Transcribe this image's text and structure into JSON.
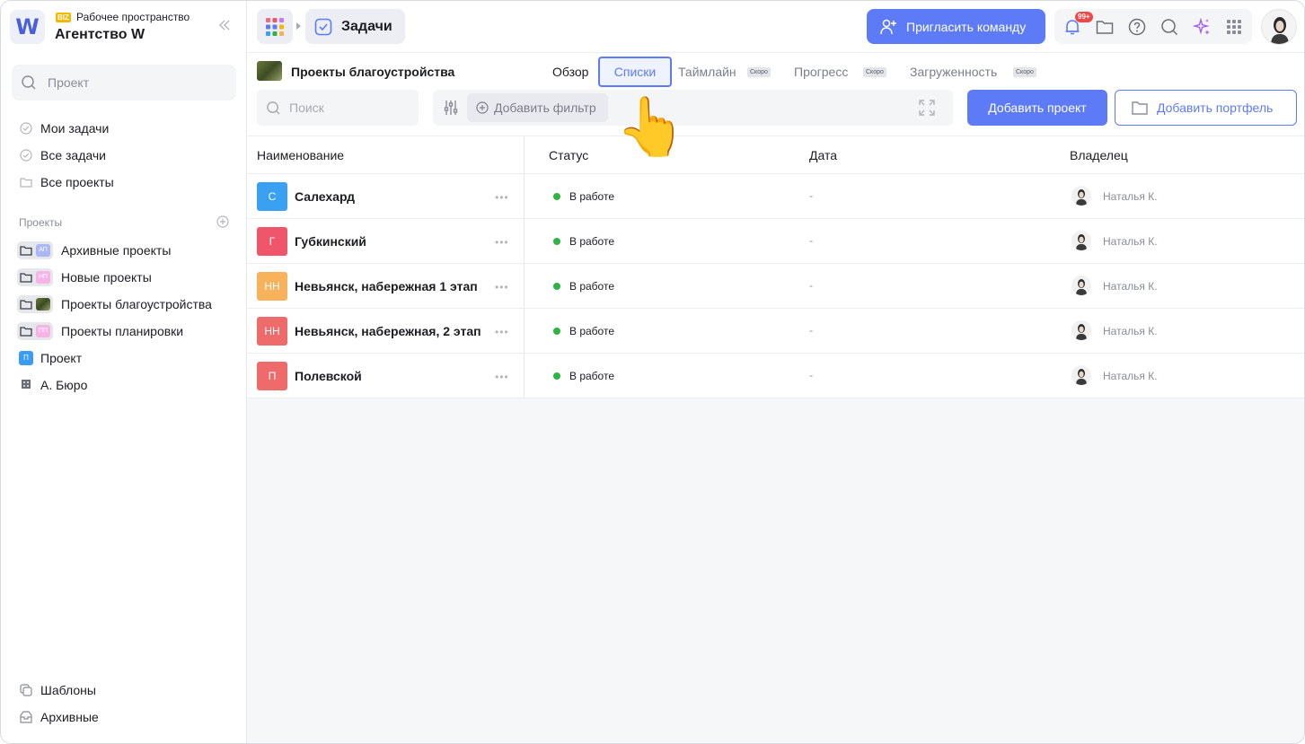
{
  "workspace": {
    "badge": "BIZ",
    "subtitle": "Рабочее пространство",
    "name": "Агентство W",
    "logo_letter": "W"
  },
  "sidebar": {
    "search_placeholder": "Проект",
    "nav": [
      {
        "label": "Мои задачи",
        "icon": "check-circle-icon"
      },
      {
        "label": "Все задачи",
        "icon": "check-circle-icon"
      },
      {
        "label": "Все проекты",
        "icon": "folder-icon"
      }
    ],
    "projects_label": "Проекты",
    "projects": [
      {
        "label": "Архивные проекты",
        "badge": "АП",
        "badge_color": "#a9b7f5"
      },
      {
        "label": "Новые проекты",
        "badge": "НП",
        "badge_color": "#f5b3e6"
      },
      {
        "label": "Проекты благоустройства",
        "badge": "",
        "badge_color": "#6b7a3a"
      },
      {
        "label": "Проекты планировки",
        "badge": "ПП",
        "badge_color": "#f5b3e6"
      }
    ],
    "singles": [
      {
        "label": "Проект",
        "badge": "П",
        "badge_color": "#3b9cf5"
      },
      {
        "label": "А. Бюро",
        "badge": "",
        "badge_color": "#6b6e76"
      }
    ],
    "footer": [
      {
        "label": "Шаблоны",
        "icon": "templates-icon"
      },
      {
        "label": "Архивные",
        "icon": "archive-icon"
      }
    ]
  },
  "topbar": {
    "breadcrumb_current": "Задачи",
    "invite_label": "Пригласить команду",
    "notifications_count": "99+"
  },
  "project": {
    "title": "Проекты благоустройства",
    "tabs": [
      {
        "label": "Обзор",
        "active": false,
        "soon": ""
      },
      {
        "label": "Списки",
        "active": true,
        "soon": ""
      },
      {
        "label": "Таймлайн",
        "active": false,
        "soon": "Скоро"
      },
      {
        "label": "Прогресс",
        "active": false,
        "soon": "Скоро"
      },
      {
        "label": "Загруженность",
        "active": false,
        "soon": "Скоро"
      }
    ],
    "search_placeholder": "Поиск",
    "add_filter_label": "Добавить фильтр",
    "add_project_label": "Добавить проект",
    "add_portfolio_label": "Добавить портфель"
  },
  "table": {
    "columns": [
      "Наименование",
      "Статус",
      "Дата",
      "Владелец"
    ],
    "rows": [
      {
        "badge": "С",
        "badge_color": "#3aa0f2",
        "name": "Салехард",
        "status": "В работе",
        "date": "-",
        "owner": "Наталья К."
      },
      {
        "badge": "Г",
        "badge_color": "#f0566b",
        "name": "Губкинский",
        "status": "В работе",
        "date": "-",
        "owner": "Наталья К."
      },
      {
        "badge": "НН",
        "badge_color": "#f9b25c",
        "name": "Невьянск, набережная 1 этап",
        "status": "В работе",
        "date": "-",
        "owner": "Наталья К."
      },
      {
        "badge": "НН",
        "badge_color": "#ef6a6a",
        "name": "Невьянск, набережная, 2 этап",
        "status": "В работе",
        "date": "-",
        "owner": "Наталья К."
      },
      {
        "badge": "П",
        "badge_color": "#ef6a6a",
        "name": "Полевской",
        "status": "В работе",
        "date": "-",
        "owner": "Наталья К."
      }
    ]
  },
  "colors": {
    "accent": "#5d7bf7",
    "status_green": "#2fb344"
  },
  "pointer": "👆"
}
